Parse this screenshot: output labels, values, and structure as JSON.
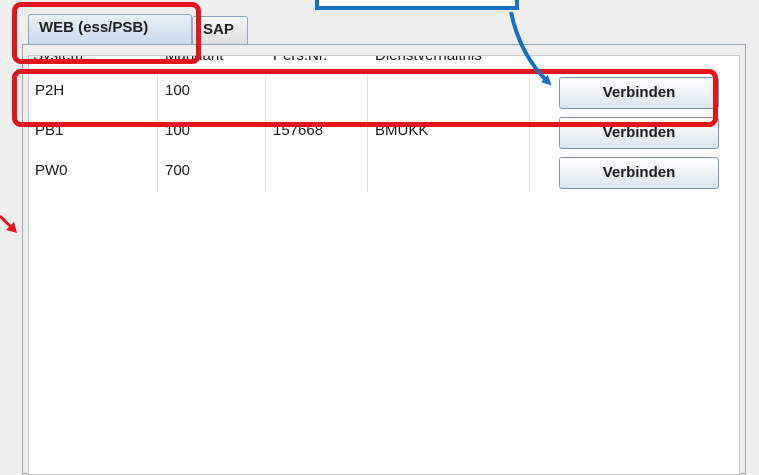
{
  "tabs": [
    {
      "label": "WEB (ess/PSB)",
      "active": true
    },
    {
      "label": "SAP",
      "active": false
    }
  ],
  "table": {
    "columns": [
      "System",
      "Mandant",
      "Pers.Nr.",
      "Dienstverhältnis"
    ],
    "rows": [
      {
        "system": "P2H",
        "mandant": "100",
        "pers_nr": "",
        "dienstverhaeltnis": "",
        "action": "Verbinden"
      },
      {
        "system": "PB1",
        "mandant": "100",
        "pers_nr": "157668",
        "dienstverhaeltnis": "BMUKK",
        "action": "Verbinden"
      },
      {
        "system": "PW0",
        "mandant": "700",
        "pers_nr": "",
        "dienstverhaeltnis": "",
        "action": "Verbinden"
      }
    ]
  },
  "colors": {
    "highlight_red": "#e3141b",
    "callout_blue": "#1870c4",
    "arrow_red": "#e3141b"
  }
}
